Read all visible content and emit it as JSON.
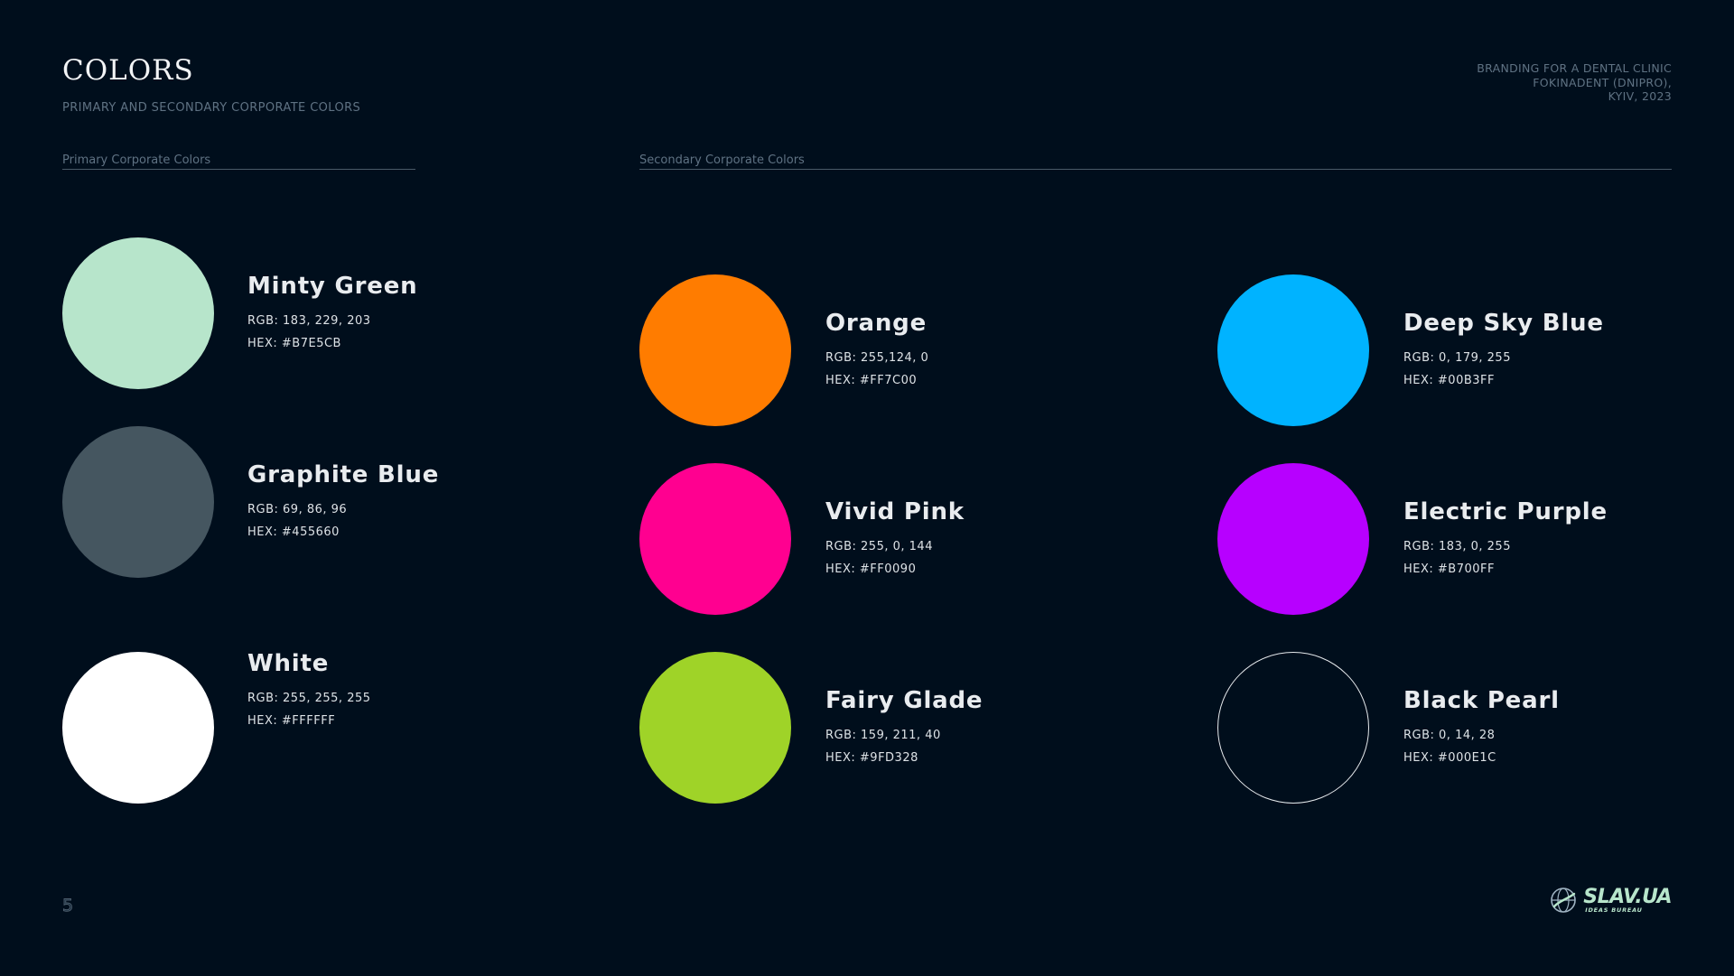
{
  "header": {
    "title": "COLORS",
    "subtitle": "PRIMARY AND SECONDARY CORPORATE COLORS",
    "project_lines": [
      "BRANDING FOR A DENTAL CLINIC",
      "FOKINADENT (DNIPRO),",
      "KYIV, 2023"
    ]
  },
  "sections": {
    "primary_label": "Primary Corporate Colors",
    "secondary_label": "Secondary Corporate Colors"
  },
  "colors": {
    "primary": [
      {
        "name": "Minty Green",
        "rgb": "RGB: 183, 229, 203",
        "hex": "HEX: #B7E5CB",
        "swatch": "#B7E5CB"
      },
      {
        "name": "Graphite Blue",
        "rgb": "RGB: 69, 86, 96",
        "hex": "HEX: #455660",
        "swatch": "#455660"
      },
      {
        "name": "White",
        "rgb": "RGB: 255, 255, 255",
        "hex": "HEX: #FFFFFF",
        "swatch": "#FFFFFF"
      }
    ],
    "secondary": [
      {
        "name": "Orange",
        "rgb": "RGB: 255,124, 0",
        "hex": "HEX: #FF7C00",
        "swatch": "#FF7C00"
      },
      {
        "name": "Deep Sky Blue",
        "rgb": "RGB: 0, 179, 255",
        "hex": "HEX: #00B3FF",
        "swatch": "#00B3FF"
      },
      {
        "name": "Vivid Pink",
        "rgb": "RGB: 255, 0, 144",
        "hex": "HEX: #FF0090",
        "swatch": "#FF0090"
      },
      {
        "name": "Electric Purple",
        "rgb": "RGB: 183, 0, 255",
        "hex": "HEX: #B700FF",
        "swatch": "#B700FF"
      },
      {
        "name": "Fairy Glade",
        "rgb": "RGB: 159, 211, 40",
        "hex": "HEX: #9FD328",
        "swatch": "#9FD328"
      },
      {
        "name": "Black Pearl",
        "rgb": "RGB: 0, 14, 28",
        "hex": "HEX: #000E1C",
        "swatch": "#000E1C"
      }
    ]
  },
  "footer": {
    "page_number": "5",
    "brand_name": "SLAV.UA",
    "brand_tagline": "IDEAS BUREAU",
    "brand_icon": "globe-icon"
  },
  "theme": {
    "background": "#000E1C",
    "accent": "#B7E5CB",
    "muted_text": "#5F7283"
  }
}
